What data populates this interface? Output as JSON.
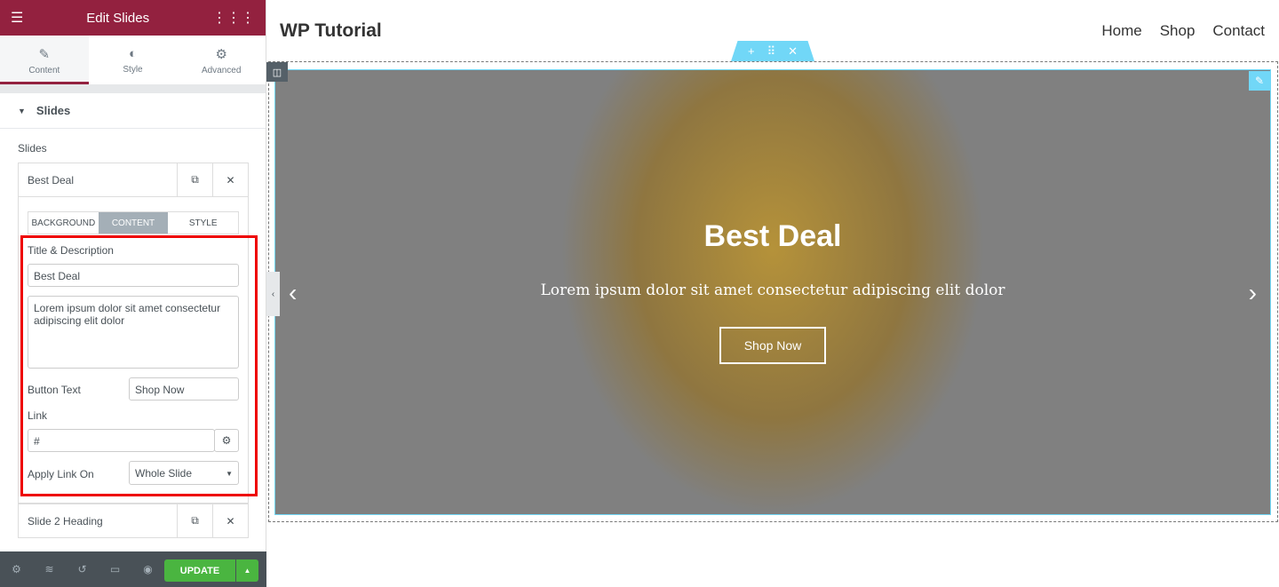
{
  "panel": {
    "title": "Edit Slides",
    "tabs": [
      {
        "label": "Content",
        "icon": "pencil-icon"
      },
      {
        "label": "Style",
        "icon": "half-circle-icon"
      },
      {
        "label": "Advanced",
        "icon": "gear-icon"
      }
    ],
    "section": "Slides",
    "slides_label": "Slides",
    "items": [
      {
        "name": "Best Deal"
      },
      {
        "name": "Slide 2 Heading"
      }
    ],
    "subtabs": [
      "BACKGROUND",
      "CONTENT",
      "STYLE"
    ],
    "fields": {
      "title_desc_label": "Title & Description",
      "title_value": "Best Deal",
      "description_value": "Lorem ipsum dolor sit amet consectetur adipiscing elit dolor",
      "button_text_label": "Button Text",
      "button_text_value": "Shop Now",
      "link_label": "Link",
      "link_value": "#",
      "apply_link_label": "Apply Link On",
      "apply_link_value": "Whole Slide"
    },
    "footer": {
      "update": "UPDATE"
    }
  },
  "site": {
    "logo": "WP Tutorial",
    "nav": [
      "Home",
      "Shop",
      "Contact"
    ],
    "slide": {
      "title": "Best Deal",
      "description": "Lorem ipsum dolor sit amet consectetur adipiscing elit dolor",
      "button": "Shop Now"
    }
  },
  "colors": {
    "brand": "#93213f",
    "accent": "#71d7f7",
    "update": "#4ab540"
  }
}
